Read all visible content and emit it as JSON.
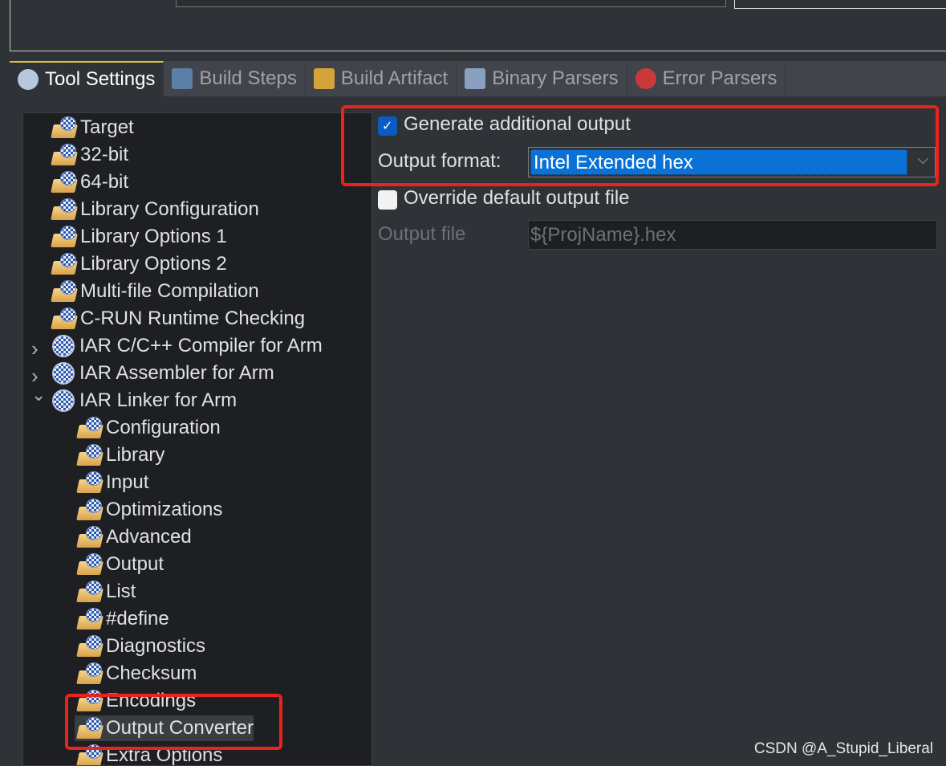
{
  "tabs": [
    {
      "label": "Tool Settings",
      "icon": "tool-settings-icon",
      "active": true
    },
    {
      "label": "Build Steps",
      "icon": "build-steps-icon"
    },
    {
      "label": "Build Artifact",
      "icon": "trophy-icon"
    },
    {
      "label": "Binary Parsers",
      "icon": "binary-icon"
    },
    {
      "label": "Error Parsers",
      "icon": "error-icon"
    }
  ],
  "tree": [
    {
      "label": "Target",
      "level": 1
    },
    {
      "label": "32-bit",
      "level": 1
    },
    {
      "label": "64-bit",
      "level": 1
    },
    {
      "label": "Library Configuration",
      "level": 1
    },
    {
      "label": "Library Options 1",
      "level": 1
    },
    {
      "label": "Library Options 2",
      "level": 1
    },
    {
      "label": "Multi-file Compilation",
      "level": 1
    },
    {
      "label": "C-RUN Runtime Checking",
      "level": 1
    },
    {
      "label": "IAR C/C++ Compiler for Arm",
      "level": 0,
      "expander": "collapsed"
    },
    {
      "label": "IAR Assembler for Arm",
      "level": 0,
      "expander": "collapsed"
    },
    {
      "label": "IAR Linker for Arm",
      "level": 0,
      "expander": "expanded"
    },
    {
      "label": "Configuration",
      "level": 2
    },
    {
      "label": "Library",
      "level": 2
    },
    {
      "label": "Input",
      "level": 2
    },
    {
      "label": "Optimizations",
      "level": 2
    },
    {
      "label": "Advanced",
      "level": 2
    },
    {
      "label": "Output",
      "level": 2
    },
    {
      "label": "List",
      "level": 2
    },
    {
      "label": "#define",
      "level": 2
    },
    {
      "label": "Diagnostics",
      "level": 2
    },
    {
      "label": "Checksum",
      "level": 2
    },
    {
      "label": "Encodings",
      "level": 2
    },
    {
      "label": "Output Converter",
      "level": 2,
      "selected": true
    },
    {
      "label": "Extra Options",
      "level": 2
    }
  ],
  "settings": {
    "generate_label": "Generate additional output",
    "generate_checked": true,
    "format_label": "Output format:",
    "format_value": "Intel Extended hex",
    "override_label": "Override default output file",
    "override_checked": false,
    "file_label": "Output file",
    "file_value": "${ProjName}.hex"
  },
  "colors": {
    "accent": "#0a72d6",
    "highlight": "#e8241c"
  },
  "watermark": "CSDN @A_Stupid_Liberal"
}
